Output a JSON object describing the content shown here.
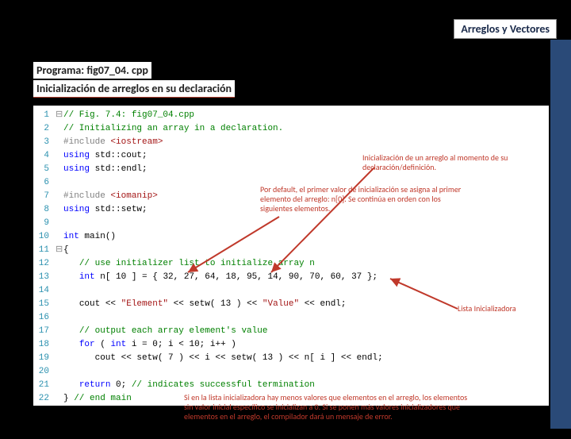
{
  "header": {
    "title": "Arreglos y Vectores"
  },
  "program": {
    "title": "Programa: fig07_04. cpp",
    "subtitle": "Inicialización de arreglos en su declaración"
  },
  "code": {
    "lines": [
      {
        "n": "1",
        "g": "⊟",
        "html": "<span class='c-comment'>// Fig. 7.4: fig07_04.cpp</span>"
      },
      {
        "n": "2",
        "g": "",
        "html": "<span class='c-comment'>// Initializing an array in a declaration.</span>"
      },
      {
        "n": "3",
        "g": "",
        "html": "<span class='c-pp'>#include</span> <span class='c-string'>&lt;iostream&gt;</span>"
      },
      {
        "n": "4",
        "g": "",
        "html": "<span class='c-keyword'>using</span> <span class='c-plain'>std::cout;</span>"
      },
      {
        "n": "5",
        "g": "",
        "html": "<span class='c-keyword'>using</span> <span class='c-plain'>std::endl;</span>"
      },
      {
        "n": "6",
        "g": "",
        "html": ""
      },
      {
        "n": "7",
        "g": "",
        "html": "<span class='c-pp'>#include</span> <span class='c-string'>&lt;iomanip&gt;</span>"
      },
      {
        "n": "8",
        "g": "",
        "html": "<span class='c-keyword'>using</span> <span class='c-plain'>std::setw;</span>"
      },
      {
        "n": "9",
        "g": "",
        "html": ""
      },
      {
        "n": "10",
        "g": "",
        "html": "<span class='c-type'>int</span> <span class='c-plain'>main()</span>"
      },
      {
        "n": "11",
        "g": "⊟",
        "html": "<span class='c-plain'>{</span>"
      },
      {
        "n": "12",
        "g": "",
        "html": "   <span class='c-comment'>// use initializer list to initialize array n</span>"
      },
      {
        "n": "13",
        "g": "",
        "html": "   <span class='c-type'>int</span> <span class='c-plain'>n[ 10 ] = { 32, 27, 64, 18, 95, 14, 90, 70, 60, 37 };</span>"
      },
      {
        "n": "14",
        "g": "",
        "html": ""
      },
      {
        "n": "15",
        "g": "",
        "html": "   <span class='c-plain'>cout &lt;&lt; </span><span class='c-string'>\"Element\"</span><span class='c-plain'> &lt;&lt; setw( 13 ) &lt;&lt; </span><span class='c-string'>\"Value\"</span><span class='c-plain'> &lt;&lt; endl;</span>"
      },
      {
        "n": "16",
        "g": "",
        "html": ""
      },
      {
        "n": "17",
        "g": "",
        "html": "   <span class='c-comment'>// output each array element's value</span>"
      },
      {
        "n": "18",
        "g": "",
        "html": "   <span class='c-keyword'>for</span><span class='c-plain'> ( </span><span class='c-type'>int</span><span class='c-plain'> i = 0; i &lt; 10; i++ )</span>"
      },
      {
        "n": "19",
        "g": "",
        "html": "      <span class='c-plain'>cout &lt;&lt; setw( 7 ) &lt;&lt; i &lt;&lt; setw( 13 ) &lt;&lt; n[ i ] &lt;&lt; endl;</span>"
      },
      {
        "n": "20",
        "g": "",
        "html": ""
      },
      {
        "n": "21",
        "g": "",
        "html": "   <span class='c-keyword'>return</span><span class='c-plain'> 0; </span><span class='c-comment'>// indicates successful termination</span>"
      },
      {
        "n": "22",
        "g": "",
        "html": "<span class='c-plain'>} </span><span class='c-comment'>// end main</span>"
      }
    ]
  },
  "annotations": {
    "a1": "Inicialización de un arreglo al momento de su declaración/definición.",
    "a2": "Por default, el primer valor de inicialización se asigna al primer elemento del arreglo: n[0]. Se continúa en orden con los siguientes elementos.",
    "a3": "Lista Inicializadora",
    "a4": "Si en la lista inicializadora hay menos valores que elementos en el arreglo, los elementos sin valor inicial específico se inicializan a 0. Si se ponen más valores inicializadores que elementos en el arreglo, el compilador dará un mensaje de error."
  }
}
